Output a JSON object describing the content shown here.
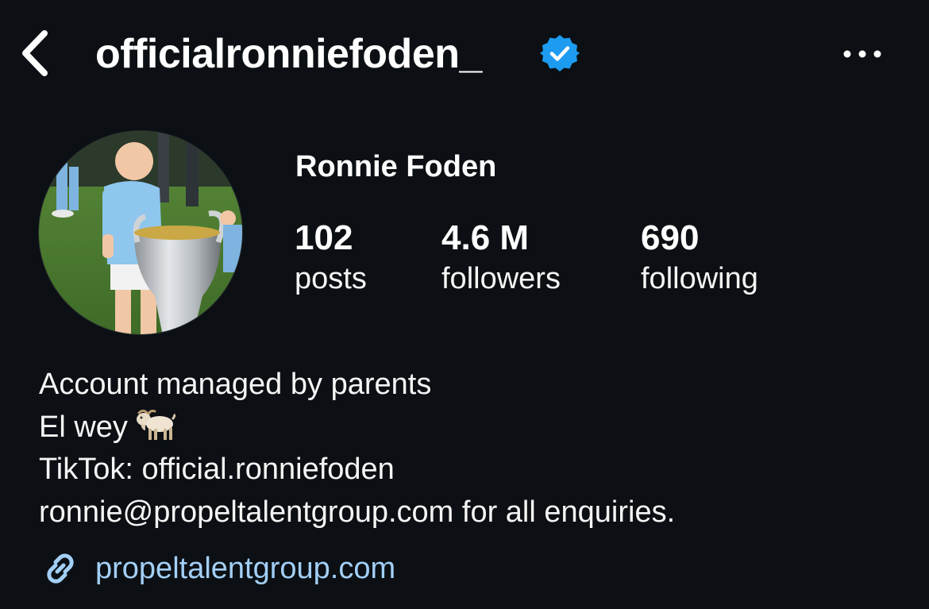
{
  "header": {
    "username": "officialronniefoden_",
    "back_icon": "chevron-left-icon",
    "verified_icon": "verified-badge-icon",
    "more_icon": "more-horizontal-icon"
  },
  "profile": {
    "display_name": "Ronnie Foden",
    "avatar_icon": "profile-photo"
  },
  "stats": {
    "posts": {
      "value": "102",
      "label": "posts"
    },
    "followers": {
      "value": "4.6 M",
      "label": "followers"
    },
    "following": {
      "value": "690",
      "label": "following"
    }
  },
  "bio": {
    "line1": "Account managed by parents",
    "line2": "El wey",
    "line2_emoji": "goat-icon",
    "line3": "TikTok: official.ronniefoden",
    "line4": "ronnie@propeltalentgroup.com for all enquiries."
  },
  "link": {
    "icon": "link-icon",
    "text": "propeltalentgroup.com"
  },
  "colors": {
    "background": "#0c1014",
    "text": "#f5f5f5",
    "verified": "#1d9bf0",
    "link": "#a3cff6"
  }
}
